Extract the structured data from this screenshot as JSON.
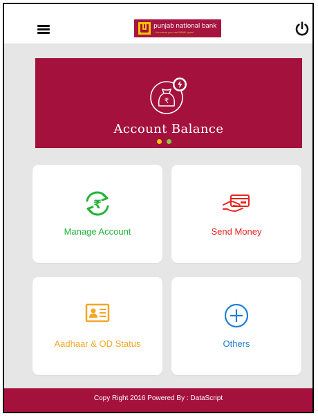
{
  "colors": {
    "brand": "#a5113d",
    "background": "#e6e6e6",
    "manage_account": "#25b33a",
    "send_money": "#e8231c",
    "aadhaar_status": "#f5a623",
    "others": "#1e7fd6",
    "dot_active": "#f5c400",
    "dot_inactive": "#8bc34a"
  },
  "header": {
    "menu_icon": "hamburger-menu-icon",
    "logo": {
      "name": "punjab national bank",
      "tagline": "...the name you can BANK upon!"
    },
    "power_icon": "power-icon"
  },
  "banner": {
    "title": "Account Balance",
    "icon": "money-bag-icon",
    "carousel": {
      "count": 2,
      "active_index": 0
    }
  },
  "tiles": [
    {
      "label": "Manage Account",
      "icon": "rupee-refresh-icon"
    },
    {
      "label": "Send Money",
      "icon": "card-hand-icon"
    },
    {
      "label": "Aadhaar & OD Status",
      "icon": "id-card-icon"
    },
    {
      "label": "Others",
      "icon": "plus-circle-icon"
    }
  ],
  "footer": {
    "text": "Copy Right 2016 Powered By : DataScript"
  }
}
